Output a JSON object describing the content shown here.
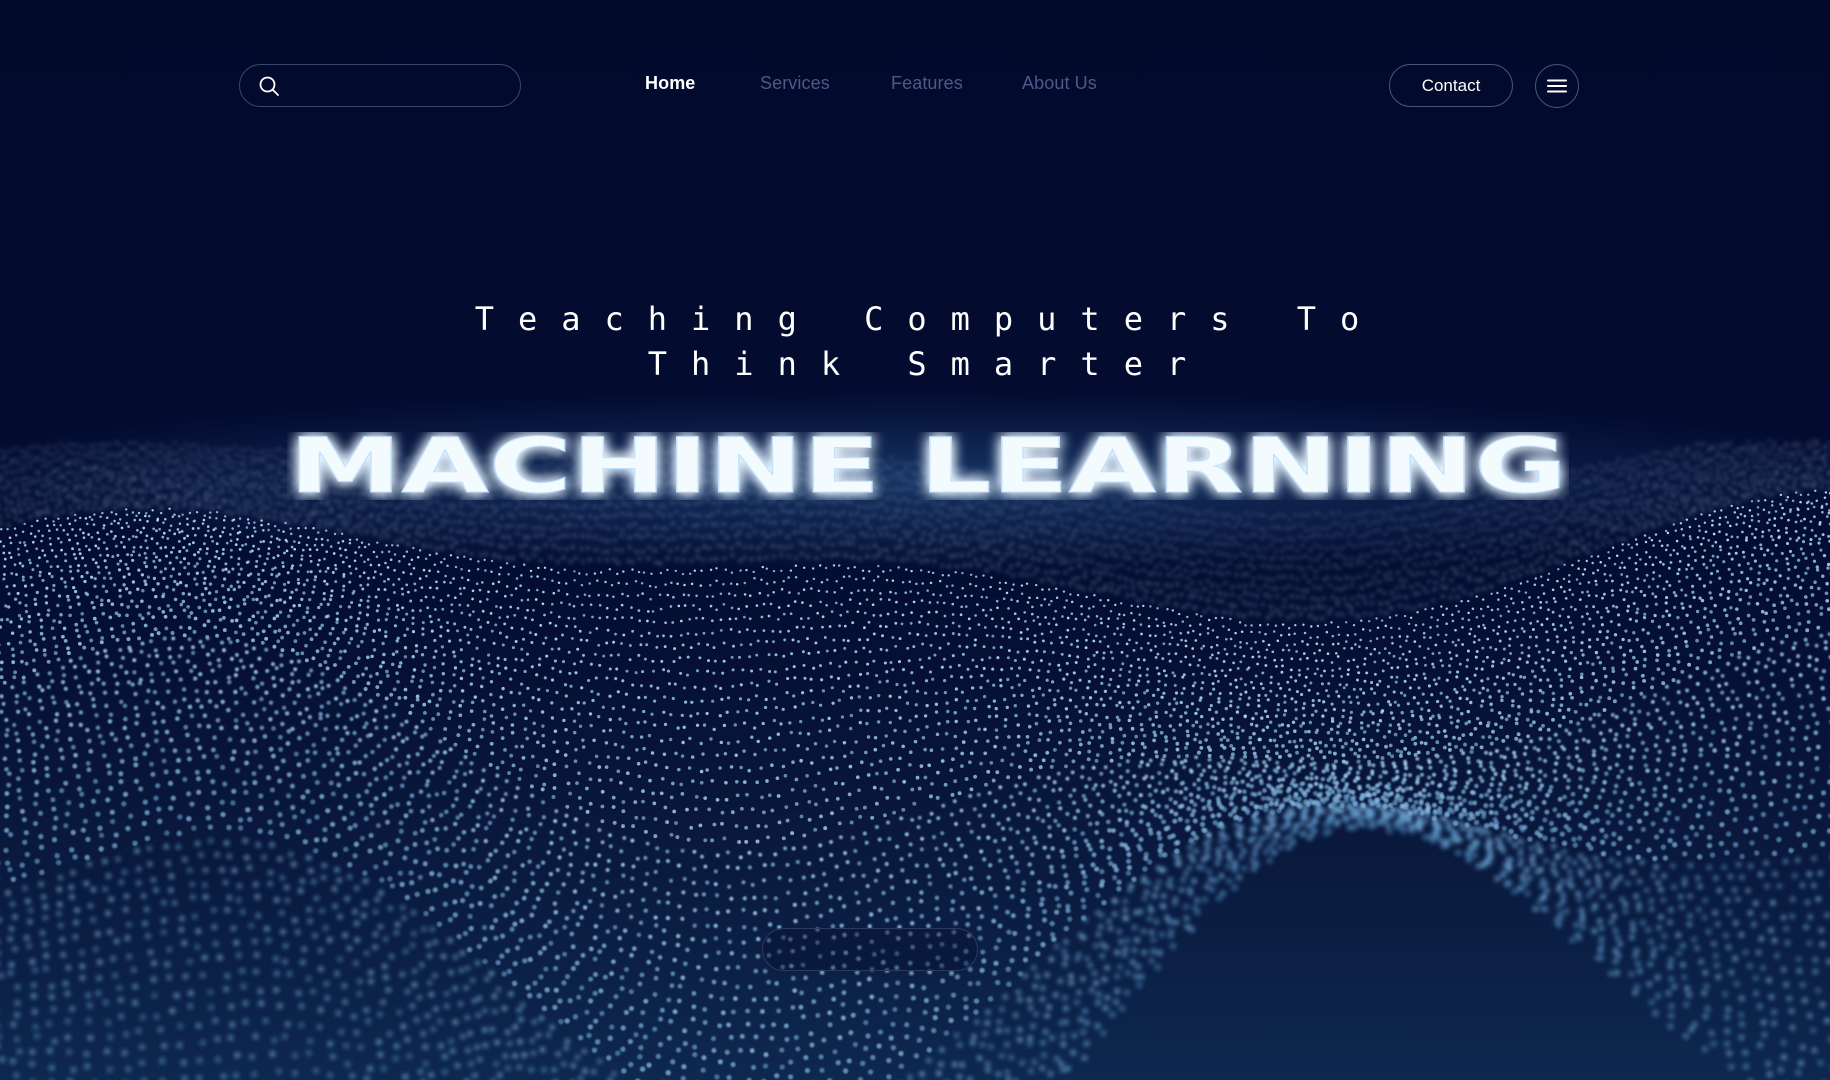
{
  "search": {
    "placeholder": "",
    "value": "",
    "icon": "search-icon"
  },
  "nav": {
    "items": [
      {
        "label": "Home",
        "active": true
      },
      {
        "label": "Services",
        "active": false
      },
      {
        "label": "Features",
        "active": false
      },
      {
        "label": "About Us",
        "active": false
      }
    ]
  },
  "header": {
    "contact_label": "Contact",
    "menu_icon": "hamburger-menu-icon"
  },
  "hero": {
    "tagline_line1": "Teaching Computers To",
    "tagline_line2": "Think Smarter",
    "title": "MACHINE LEARNING",
    "cta_label": ""
  },
  "colors": {
    "background": "#030a2b",
    "nav_inactive": "#4e5986",
    "nav_active": "#ffffff",
    "glow": "#9fd4ff",
    "particles": "#5aa8e0"
  }
}
